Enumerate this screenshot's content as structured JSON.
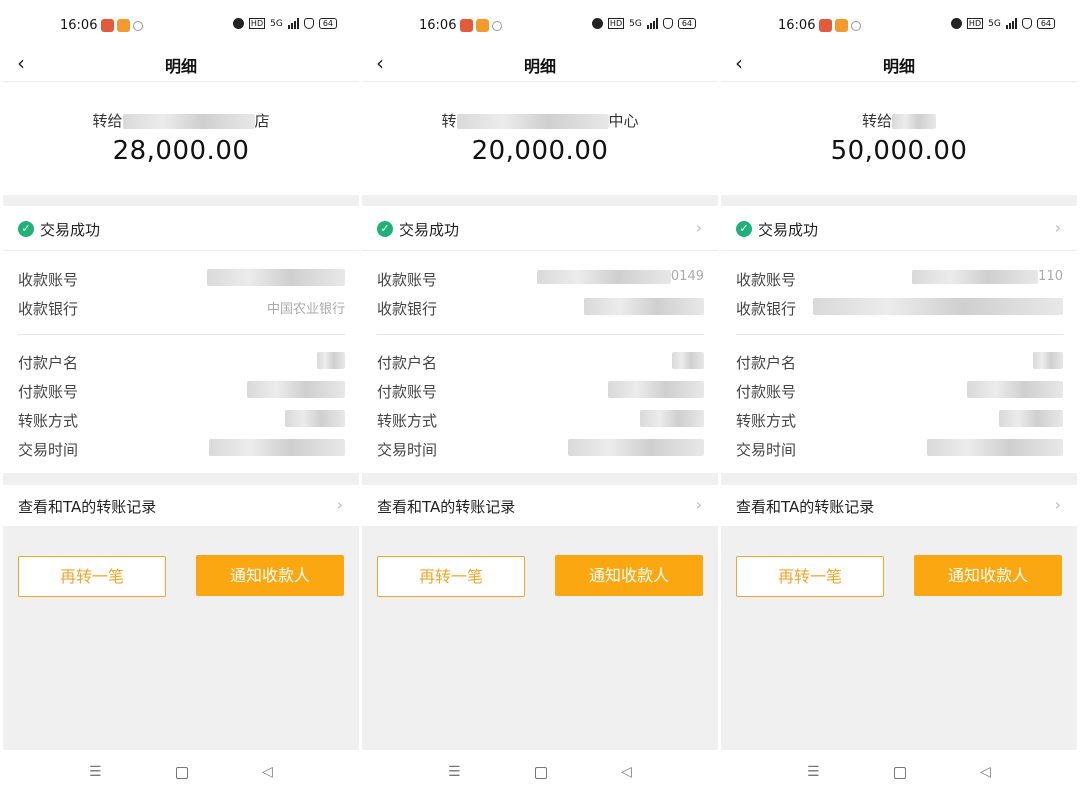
{
  "screens": [
    {
      "status_bar": {
        "time": "16:06",
        "battery": "64",
        "network": "5G"
      },
      "title": "明细",
      "payee_prefix": "转给",
      "payee_suffix": "店",
      "amount": "28,000.00",
      "status_text": "交易成功",
      "fields": {
        "recv_account_label": "收款账号",
        "recv_account_value": "",
        "recv_bank_label": "收款银行",
        "recv_bank_value": "中国农业银行",
        "payer_name_label": "付款户名",
        "payer_account_label": "付款账号",
        "transfer_method_label": "转账方式",
        "time_label": "交易时间"
      },
      "record_link": "查看和TA的转账记录",
      "btn_again": "再转一笔",
      "btn_notify": "通知收款人"
    },
    {
      "status_bar": {
        "time": "16:06",
        "battery": "64",
        "network": "5G"
      },
      "title": "明细",
      "payee_prefix": "转",
      "payee_suffix": "中心",
      "amount": "20,000.00",
      "status_text": "交易成功",
      "fields": {
        "recv_account_label": "收款账号",
        "recv_account_value": "0149",
        "recv_bank_label": "收款银行",
        "recv_bank_value": "",
        "payer_name_label": "付款户名",
        "payer_account_label": "付款账号",
        "transfer_method_label": "转账方式",
        "time_label": "交易时间"
      },
      "record_link": "查看和TA的转账记录",
      "btn_again": "再转一笔",
      "btn_notify": "通知收款人"
    },
    {
      "status_bar": {
        "time": "16:06",
        "battery": "64",
        "network": "5G"
      },
      "title": "明细",
      "payee_prefix": "转给",
      "payee_suffix": "",
      "amount": "50,000.00",
      "status_text": "交易成功",
      "fields": {
        "recv_account_label": "收款账号",
        "recv_account_value": "110",
        "recv_bank_label": "收款银行",
        "recv_bank_value": "",
        "payer_name_label": "付款户名",
        "payer_account_label": "付款账号",
        "transfer_method_label": "转账方式",
        "time_label": "交易时间"
      },
      "record_link": "查看和TA的转账记录",
      "btn_again": "再转一笔",
      "btn_notify": "通知收款人"
    }
  ],
  "colors": {
    "accent": "#fba711",
    "success": "#21b07a"
  },
  "icons": [
    "back-arrow-icon",
    "check-circle-icon",
    "chevron-right-icon",
    "menu-nav-icon",
    "home-nav-icon",
    "back-nav-icon"
  ]
}
